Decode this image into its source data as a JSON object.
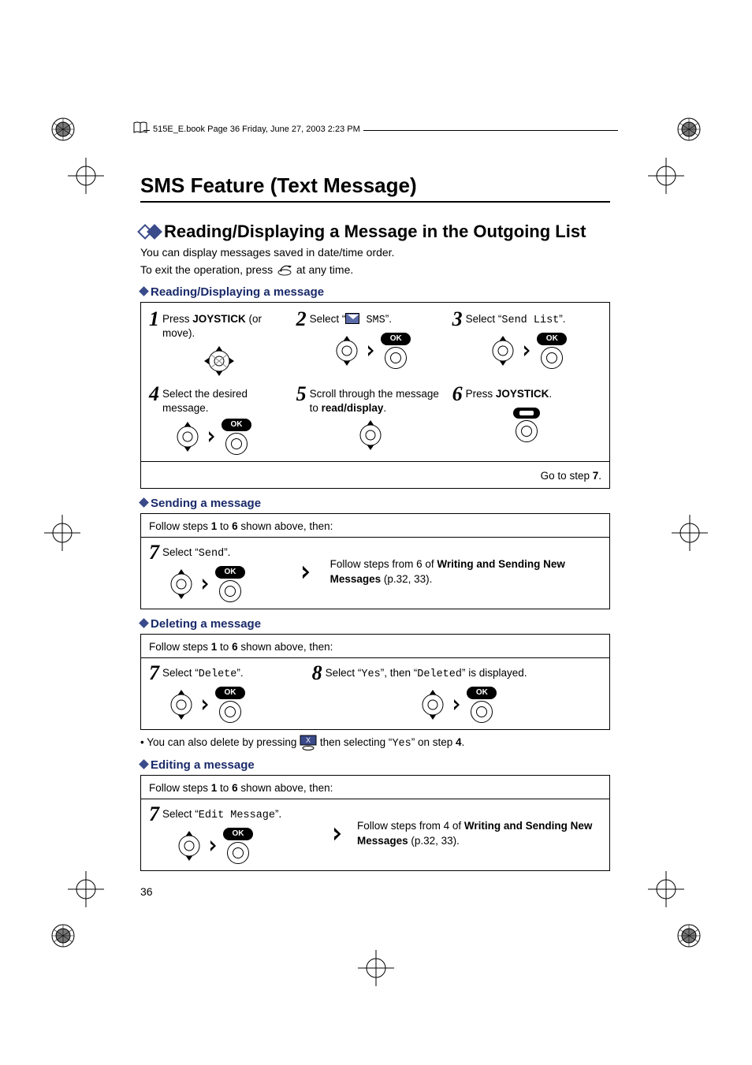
{
  "header_runner": "515E_E.book  Page 36  Friday, June 27, 2003  2:23 PM",
  "title": "SMS Feature (Text Message)",
  "section_heading": "Reading/Displaying a Message in the Outgoing List",
  "intro_line1": "You can display messages saved in date/time order.",
  "intro_line2_a": "To exit the operation, press ",
  "intro_line2_b": " at any time.",
  "sub_reading": "Reading/Displaying a message",
  "step1_a": "Press ",
  "step1_b": "JOYSTICK",
  "step1_c": " (or move).",
  "step2_a": "Select “",
  "step2_sms": " SMS",
  "step2_b": "”.",
  "step3_a": "Select “",
  "step3_mono": "Send List",
  "step3_b": "”.",
  "step4": "Select the desired message.",
  "step5_a": "Scroll through the message to ",
  "step5_b": "read/display",
  "step5_c": ".",
  "step6_a": "Press ",
  "step6_b": "JOYSTICK",
  "step6_c": ".",
  "goto_a": "Go to step ",
  "goto_b": "7",
  "goto_c": ".",
  "sub_sending": "Sending a message",
  "follow_steps_a": "Follow steps ",
  "follow_steps_b": "1",
  "follow_steps_c": " to ",
  "follow_steps_d": "6",
  "follow_steps_e": " shown above, then:",
  "send7_a": "Select “",
  "send7_mono": "Send",
  "send7_b": "”.",
  "send_ref_a": "Follow steps from 6 of ",
  "send_ref_b": "Writing and Sending New Messages",
  "send_ref_c": " (p.32, 33).",
  "sub_deleting": "Deleting a message",
  "del7_a": "Select “",
  "del7_mono": "Delete",
  "del7_b": "”.",
  "del8_a": "Select “",
  "del8_yes": "Yes",
  "del8_b": "”, then “",
  "del8_deleted": "Deleted",
  "del8_c": "” is displayed.",
  "del_note_a": "You can also delete by pressing ",
  "del_note_b": " then selecting “",
  "del_note_yes": "Yes",
  "del_note_c": "” on step ",
  "del_note_d": "4",
  "del_note_e": ".",
  "sub_editing": "Editing a message",
  "edit7_a": "Select “",
  "edit7_mono": "Edit Message",
  "edit7_b": "”.",
  "edit_ref_a": "Follow steps from 4 of ",
  "edit_ref_b": "Writing and Sending New Messages",
  "edit_ref_c": " (p.32, 33).",
  "page_number": "36",
  "ok_label": "OK"
}
